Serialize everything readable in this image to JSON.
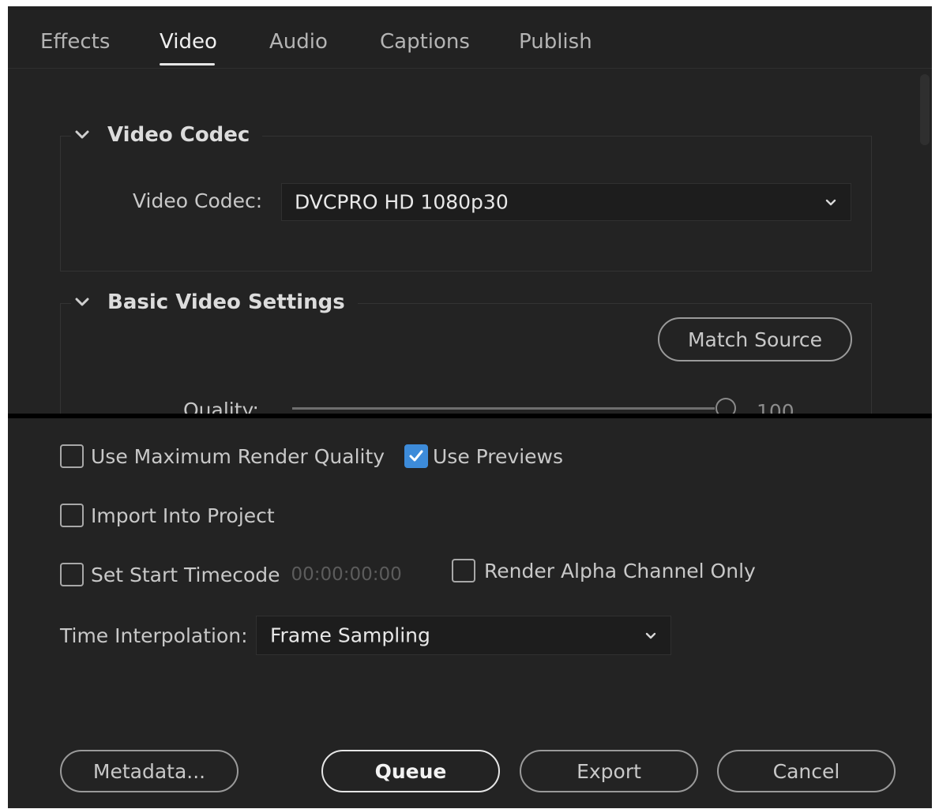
{
  "tabs": [
    {
      "label": "Effects",
      "active": false
    },
    {
      "label": "Video",
      "active": true
    },
    {
      "label": "Audio",
      "active": false
    },
    {
      "label": "Captions",
      "active": false
    },
    {
      "label": "Publish",
      "active": false
    }
  ],
  "video_codec_section": {
    "title": "Video Codec",
    "expanded": true,
    "codec_label": "Video Codec:",
    "codec_value": "DVCPRO HD 1080p30"
  },
  "basic_video_section": {
    "title": "Basic Video Settings",
    "expanded": true,
    "match_source_label": "Match Source",
    "quality_label": "Quality:",
    "quality_value": "100"
  },
  "options": {
    "max_render_quality": {
      "label": "Use Maximum Render Quality",
      "checked": false
    },
    "use_previews": {
      "label": "Use Previews",
      "checked": true
    },
    "import_into_project": {
      "label": "Import Into Project",
      "checked": false
    },
    "set_start_timecode": {
      "label": "Set Start Timecode",
      "checked": false,
      "timecode": "00:00:00:00"
    },
    "render_alpha_only": {
      "label": "Render Alpha Channel Only",
      "checked": false
    }
  },
  "time_interpolation": {
    "label": "Time Interpolation:",
    "value": "Frame Sampling"
  },
  "footer": {
    "metadata_label": "Metadata...",
    "queue_label": "Queue",
    "export_label": "Export",
    "cancel_label": "Cancel"
  },
  "colors": {
    "background": "#232323",
    "accent_checkbox": "#3d8bd9",
    "text": "#c8c8c8"
  }
}
